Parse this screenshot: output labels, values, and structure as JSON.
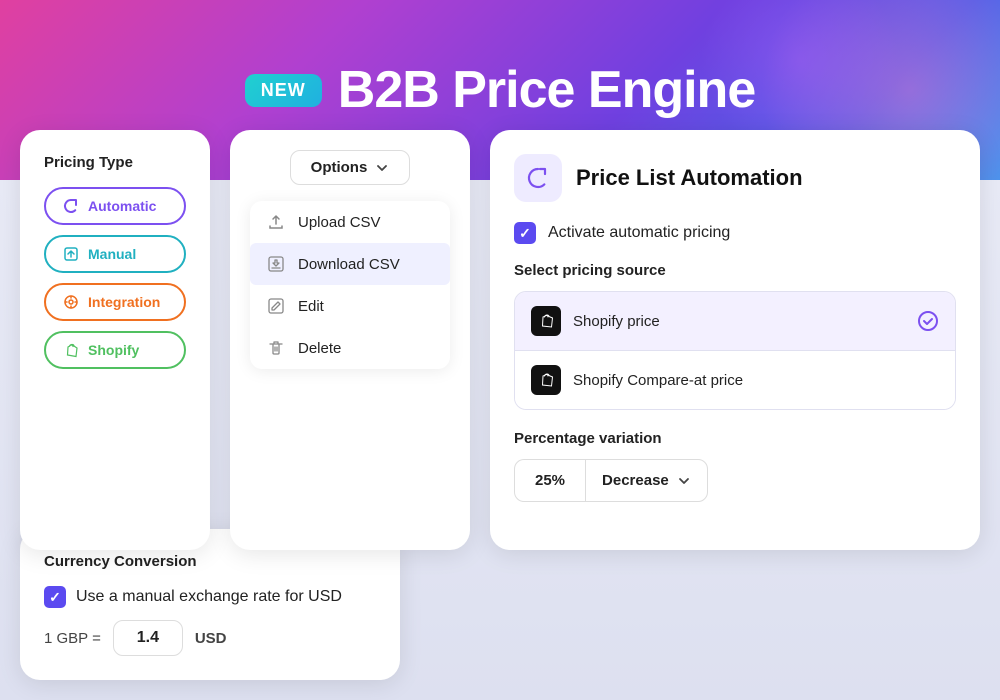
{
  "header": {
    "badge": "NEW",
    "title": "B2B Price Engine"
  },
  "pricing_type_card": {
    "title": "Pricing Type",
    "options": [
      {
        "label": "Automatic",
        "style": "automatic",
        "icon": "↻"
      },
      {
        "label": "Manual",
        "style": "manual",
        "icon": "⬆"
      },
      {
        "label": "Integration",
        "style": "integration",
        "icon": "⚙"
      },
      {
        "label": "Shopify",
        "style": "shopify",
        "icon": "S"
      }
    ]
  },
  "options_card": {
    "button_label": "Options",
    "menu_items": [
      {
        "label": "Upload CSV",
        "icon": "upload"
      },
      {
        "label": "Download CSV",
        "icon": "download",
        "active": true
      },
      {
        "label": "Edit",
        "icon": "edit"
      },
      {
        "label": "Delete",
        "icon": "trash"
      }
    ]
  },
  "automation_card": {
    "title": "Price List Automation",
    "activate_label": "Activate automatic pricing",
    "source_label": "Select pricing source",
    "sources": [
      {
        "label": "Shopify price",
        "selected": true
      },
      {
        "label": "Shopify Compare-at price",
        "selected": false
      }
    ],
    "variation_label": "Percentage variation",
    "variation_percent": "25%",
    "variation_type": "Decrease"
  },
  "currency_card": {
    "title": "Currency Conversion",
    "checkbox_label": "Use a manual exchange rate for USD",
    "from_currency": "1 GBP =",
    "rate": "1.4",
    "to_currency": "USD"
  }
}
